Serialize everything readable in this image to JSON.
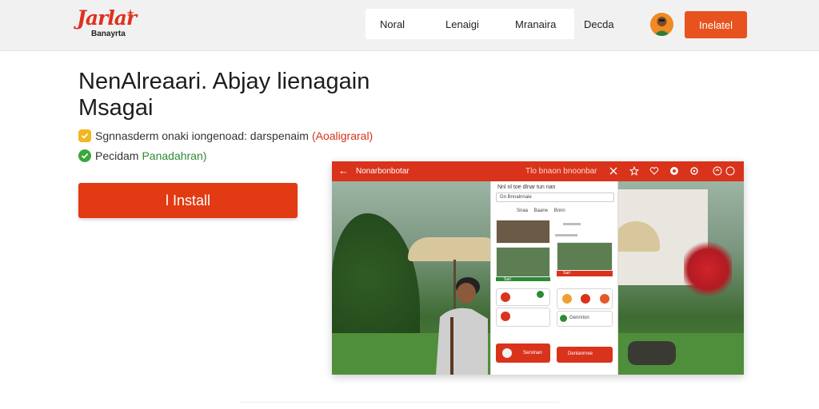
{
  "header": {
    "logo": {
      "mark": "Jarlar",
      "sub": "Banayrta"
    },
    "nav": [
      "Noral",
      "Lenaigi",
      "Mranaira",
      "Decda"
    ],
    "cta_label": "Inelatel"
  },
  "hero": {
    "title": "NenAlreaari. Abjay lienagain Msagai",
    "features": [
      {
        "text": "Sgnnasderm onaki iongenoad: darspenaim",
        "highlight": "(Aoaligraral)"
      },
      {
        "text": "Pecidam",
        "highlight": "Panadahran)"
      }
    ],
    "install_label": "l Install"
  },
  "screenshot": {
    "bar_title": "Nonarbonbotar",
    "bar_right": "Tlo bnaon bnoonbar",
    "phone": {
      "header": "Nnl  nl toe  dlnar  tun  nan",
      "search": "Gn  Bnnalnnaie",
      "tabs": "Snaa  Baane  Bnnn",
      "card1_label": "Sarl",
      "card2_label": "Sarl",
      "card3_label": "Gennrion",
      "card4_label": "Serslnan",
      "red_btn_label": "Denlanrnee"
    }
  },
  "colors": {
    "accent": "#e23a12",
    "topbar": "#f1f1f2",
    "brand_red": "#d9331c"
  },
  "icons": [
    "back-arrow-icon",
    "close-icon",
    "star-icon",
    "heart-icon",
    "record-icon",
    "settings-icon",
    "refresh-icon",
    "check-icon",
    "shield-check-icon",
    "user-avatar-icon"
  ]
}
